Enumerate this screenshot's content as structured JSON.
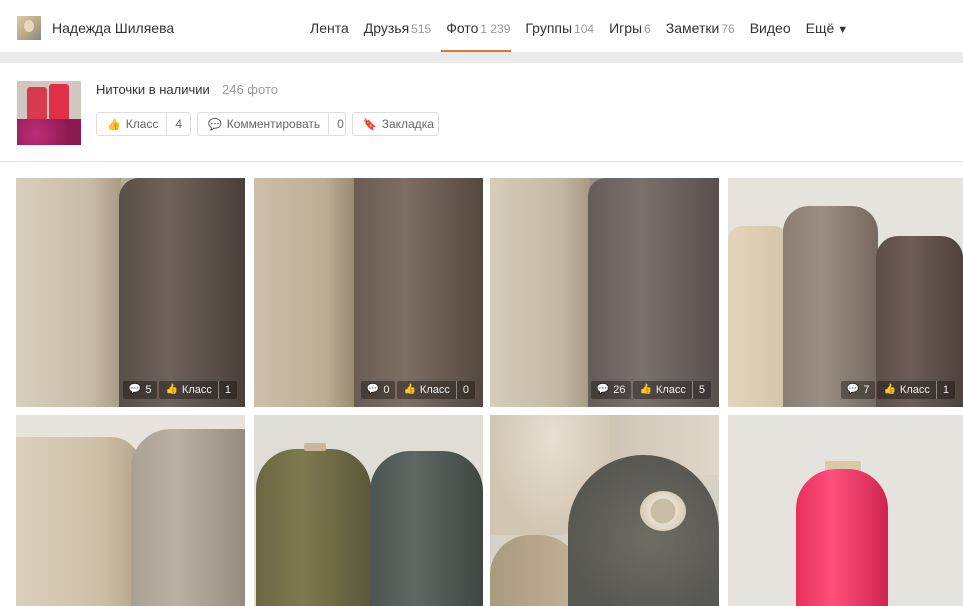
{
  "user": {
    "name": "Надежда Шиляева"
  },
  "nav": [
    {
      "label": "Лента",
      "count": ""
    },
    {
      "label": "Друзья",
      "count": "515"
    },
    {
      "label": "Фото",
      "count": "1 239"
    },
    {
      "label": "Группы",
      "count": "104"
    },
    {
      "label": "Игры",
      "count": "6"
    },
    {
      "label": "Заметки",
      "count": "76"
    },
    {
      "label": "Видео",
      "count": ""
    },
    {
      "label": "Ещё",
      "count": ""
    }
  ],
  "album": {
    "title": "Ниточки в наличии",
    "count": "246 фото",
    "klass_label": "Класс",
    "klass_count": "4",
    "comment_label": "Комментировать",
    "comment_count": "0",
    "bookmark_label": "Закладка"
  },
  "photos": [
    {
      "comments": "5",
      "klass_label": "Класс",
      "klass": "1"
    },
    {
      "comments": "0",
      "klass_label": "Класс",
      "klass": "0"
    },
    {
      "comments": "26",
      "klass_label": "Класс",
      "klass": "5"
    },
    {
      "comments": "7",
      "klass_label": "Класс",
      "klass": "1"
    },
    {},
    {},
    {},
    {}
  ],
  "colors": {
    "accent": "#eb722e"
  }
}
